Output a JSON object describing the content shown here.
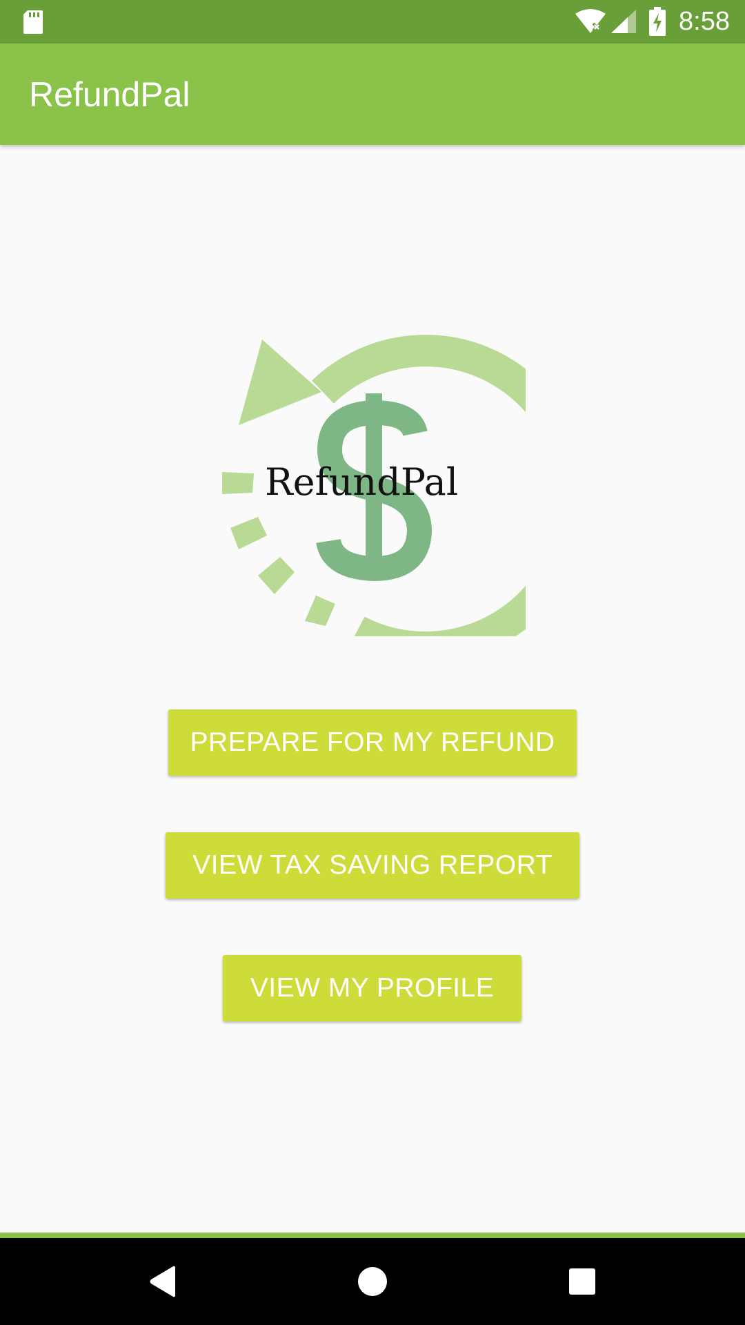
{
  "status_bar": {
    "time": "8:58",
    "icons": [
      "sd-card-icon",
      "wifi-icon",
      "signal-icon",
      "battery-charging-icon"
    ]
  },
  "app_bar": {
    "title": "RefundPal"
  },
  "logo": {
    "text": "RefundPal",
    "icon": "refund-dollar-arrow-logo"
  },
  "buttons": {
    "prepare": "PREPARE FOR MY REFUND",
    "report": "VIEW TAX SAVING REPORT",
    "profile": "VIEW MY PROFILE"
  },
  "nav_bar": {
    "icons": [
      "back-icon",
      "home-icon",
      "recents-icon"
    ]
  },
  "colors": {
    "status_bar": "#689f38",
    "app_bar": "#8bc34a",
    "button": "#cddc39",
    "logo_light_green": "#b8da94",
    "logo_dollar_green": "#7fb686"
  }
}
